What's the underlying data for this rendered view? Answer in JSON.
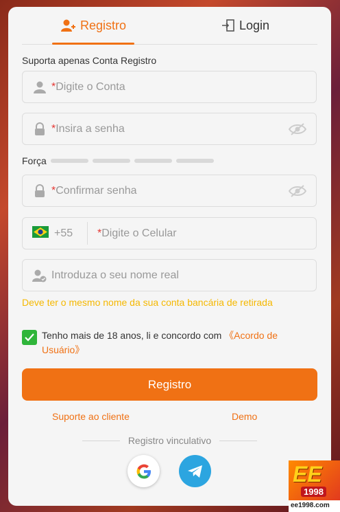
{
  "tabs": {
    "register": "Registro",
    "login": "Login"
  },
  "support_label": "Suporta apenas Conta Registro",
  "fields": {
    "account": {
      "required": "*",
      "placeholder": "Digite o Conta"
    },
    "password": {
      "required": "*",
      "placeholder": "Insira a senha"
    },
    "confirm": {
      "required": "*",
      "placeholder": "Confirmar senha"
    },
    "phone": {
      "prefix": "+55",
      "required": "*",
      "placeholder": "Digite o Celular"
    },
    "realname": {
      "placeholder": "Introduza o seu nome real"
    }
  },
  "strength_label": "Força",
  "warning": "Deve ter o mesmo nome da sua conta bancária de retirada",
  "agreement": {
    "text": "Tenho mais de 18 anos, li e concordo com ",
    "link": "《Acordo de Usuário》",
    "checked": true
  },
  "submit_label": "Registro",
  "links": {
    "support": "Suporte ao cliente",
    "demo": "Demo"
  },
  "divider": "Registro vinculativo",
  "brand": {
    "logo_text": "EE",
    "year": "1998",
    "domain": "ee1998.com"
  },
  "colors": {
    "accent": "#f07114",
    "check": "#2fb53a",
    "warning": "#f5b800"
  }
}
